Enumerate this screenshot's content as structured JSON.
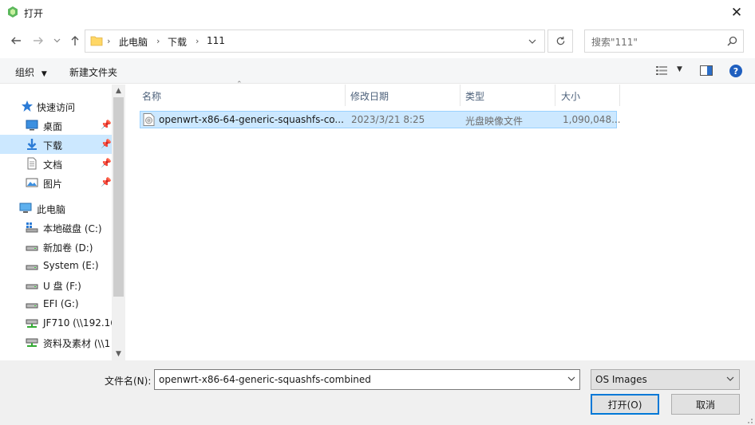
{
  "window": {
    "title": "打开"
  },
  "nav": {
    "breadcrumb": [
      "此电脑",
      "下载",
      "111"
    ],
    "search_placeholder": "搜索\"111\""
  },
  "toolbar": {
    "organize": "组织",
    "new_folder": "新建文件夹"
  },
  "sidebar": {
    "items": [
      {
        "label": "快速访问",
        "icon": "star-icon"
      },
      {
        "label": "桌面",
        "icon": "desktop-icon",
        "pinned": true
      },
      {
        "label": "下载",
        "icon": "download-icon",
        "pinned": true,
        "selected": true
      },
      {
        "label": "文档",
        "icon": "document-icon",
        "pinned": true
      },
      {
        "label": "图片",
        "icon": "picture-icon",
        "pinned": true
      },
      {
        "label": "此电脑",
        "icon": "computer-icon"
      },
      {
        "label": "本地磁盘 (C:)",
        "icon": "os-drive-icon"
      },
      {
        "label": "新加卷 (D:)",
        "icon": "drive-icon"
      },
      {
        "label": "System (E:)",
        "icon": "drive-icon"
      },
      {
        "label": "U 盘 (F:)",
        "icon": "drive-icon"
      },
      {
        "label": "EFI (G:)",
        "icon": "drive-icon"
      },
      {
        "label": "JF710 (\\\\192.16",
        "icon": "network-drive-icon"
      },
      {
        "label": "资料及素材 (\\\\1",
        "icon": "network-drive-icon"
      }
    ]
  },
  "columns": {
    "name": "名称",
    "modified": "修改日期",
    "type": "类型",
    "size": "大小"
  },
  "files": [
    {
      "name": "openwrt-x86-64-generic-squashfs-co...",
      "modified": "2023/3/21 8:25",
      "type": "光盘映像文件",
      "size": "1,090,048..."
    }
  ],
  "footer": {
    "filename_label": "文件名(N):",
    "filename_value": "openwrt-x86-64-generic-squashfs-combined",
    "filetype": "OS Images",
    "open_button": "打开(O)",
    "cancel_button": "取消"
  },
  "colors": {
    "selection": "#cce8ff",
    "accent": "#0078d7"
  }
}
